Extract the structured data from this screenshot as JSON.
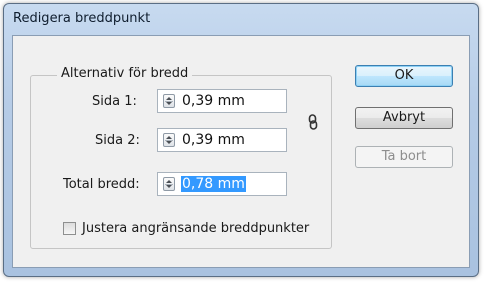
{
  "window": {
    "title": "Redigera breddpunkt"
  },
  "group": {
    "legend": "Alternativ för bredd"
  },
  "fields": {
    "side1": {
      "label": "Sida 1:",
      "value": "0,39 mm"
    },
    "side2": {
      "label": "Sida 2:",
      "value": "0,39 mm"
    },
    "total": {
      "label": "Total bredd:",
      "value": "0,78 mm"
    }
  },
  "checkbox": {
    "label": "Justera angränsande breddpunkter",
    "checked": false
  },
  "buttons": {
    "ok": "OK",
    "cancel": "Avbryt",
    "delete": "Ta bort"
  },
  "colors": {
    "title_bar": "#b5cbe6",
    "selection": "#3399ff",
    "default_button": "#bee6fd"
  }
}
